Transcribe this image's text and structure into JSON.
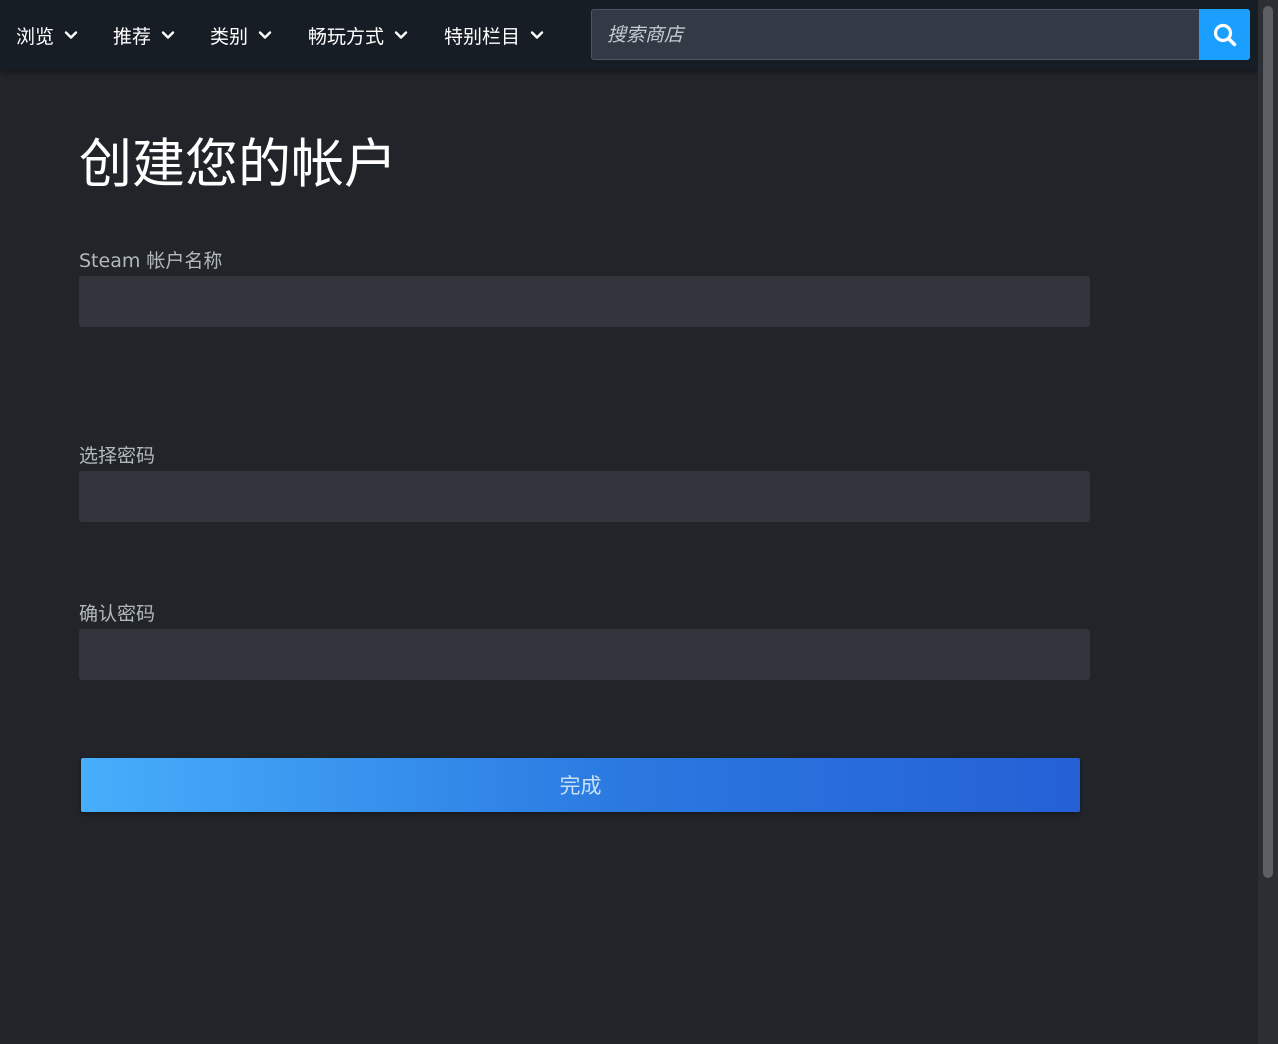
{
  "nav": {
    "items": [
      {
        "label": "浏览"
      },
      {
        "label": "推荐"
      },
      {
        "label": "类别"
      },
      {
        "label": "畅玩方式"
      },
      {
        "label": "特别栏目"
      }
    ],
    "search": {
      "placeholder": "搜索商店",
      "button_icon": "search-icon"
    }
  },
  "form": {
    "title": "创建您的帐户",
    "fields": [
      {
        "label": "Steam 帐户名称",
        "value": ""
      },
      {
        "label": "选择密码",
        "value": ""
      },
      {
        "label": "确认密码",
        "value": ""
      }
    ],
    "submit_label": "完成"
  },
  "colors": {
    "page_bg": "#212429",
    "nav_bg": "#171d25",
    "accent": "#1a9fff",
    "input_bg": "#32353c"
  }
}
